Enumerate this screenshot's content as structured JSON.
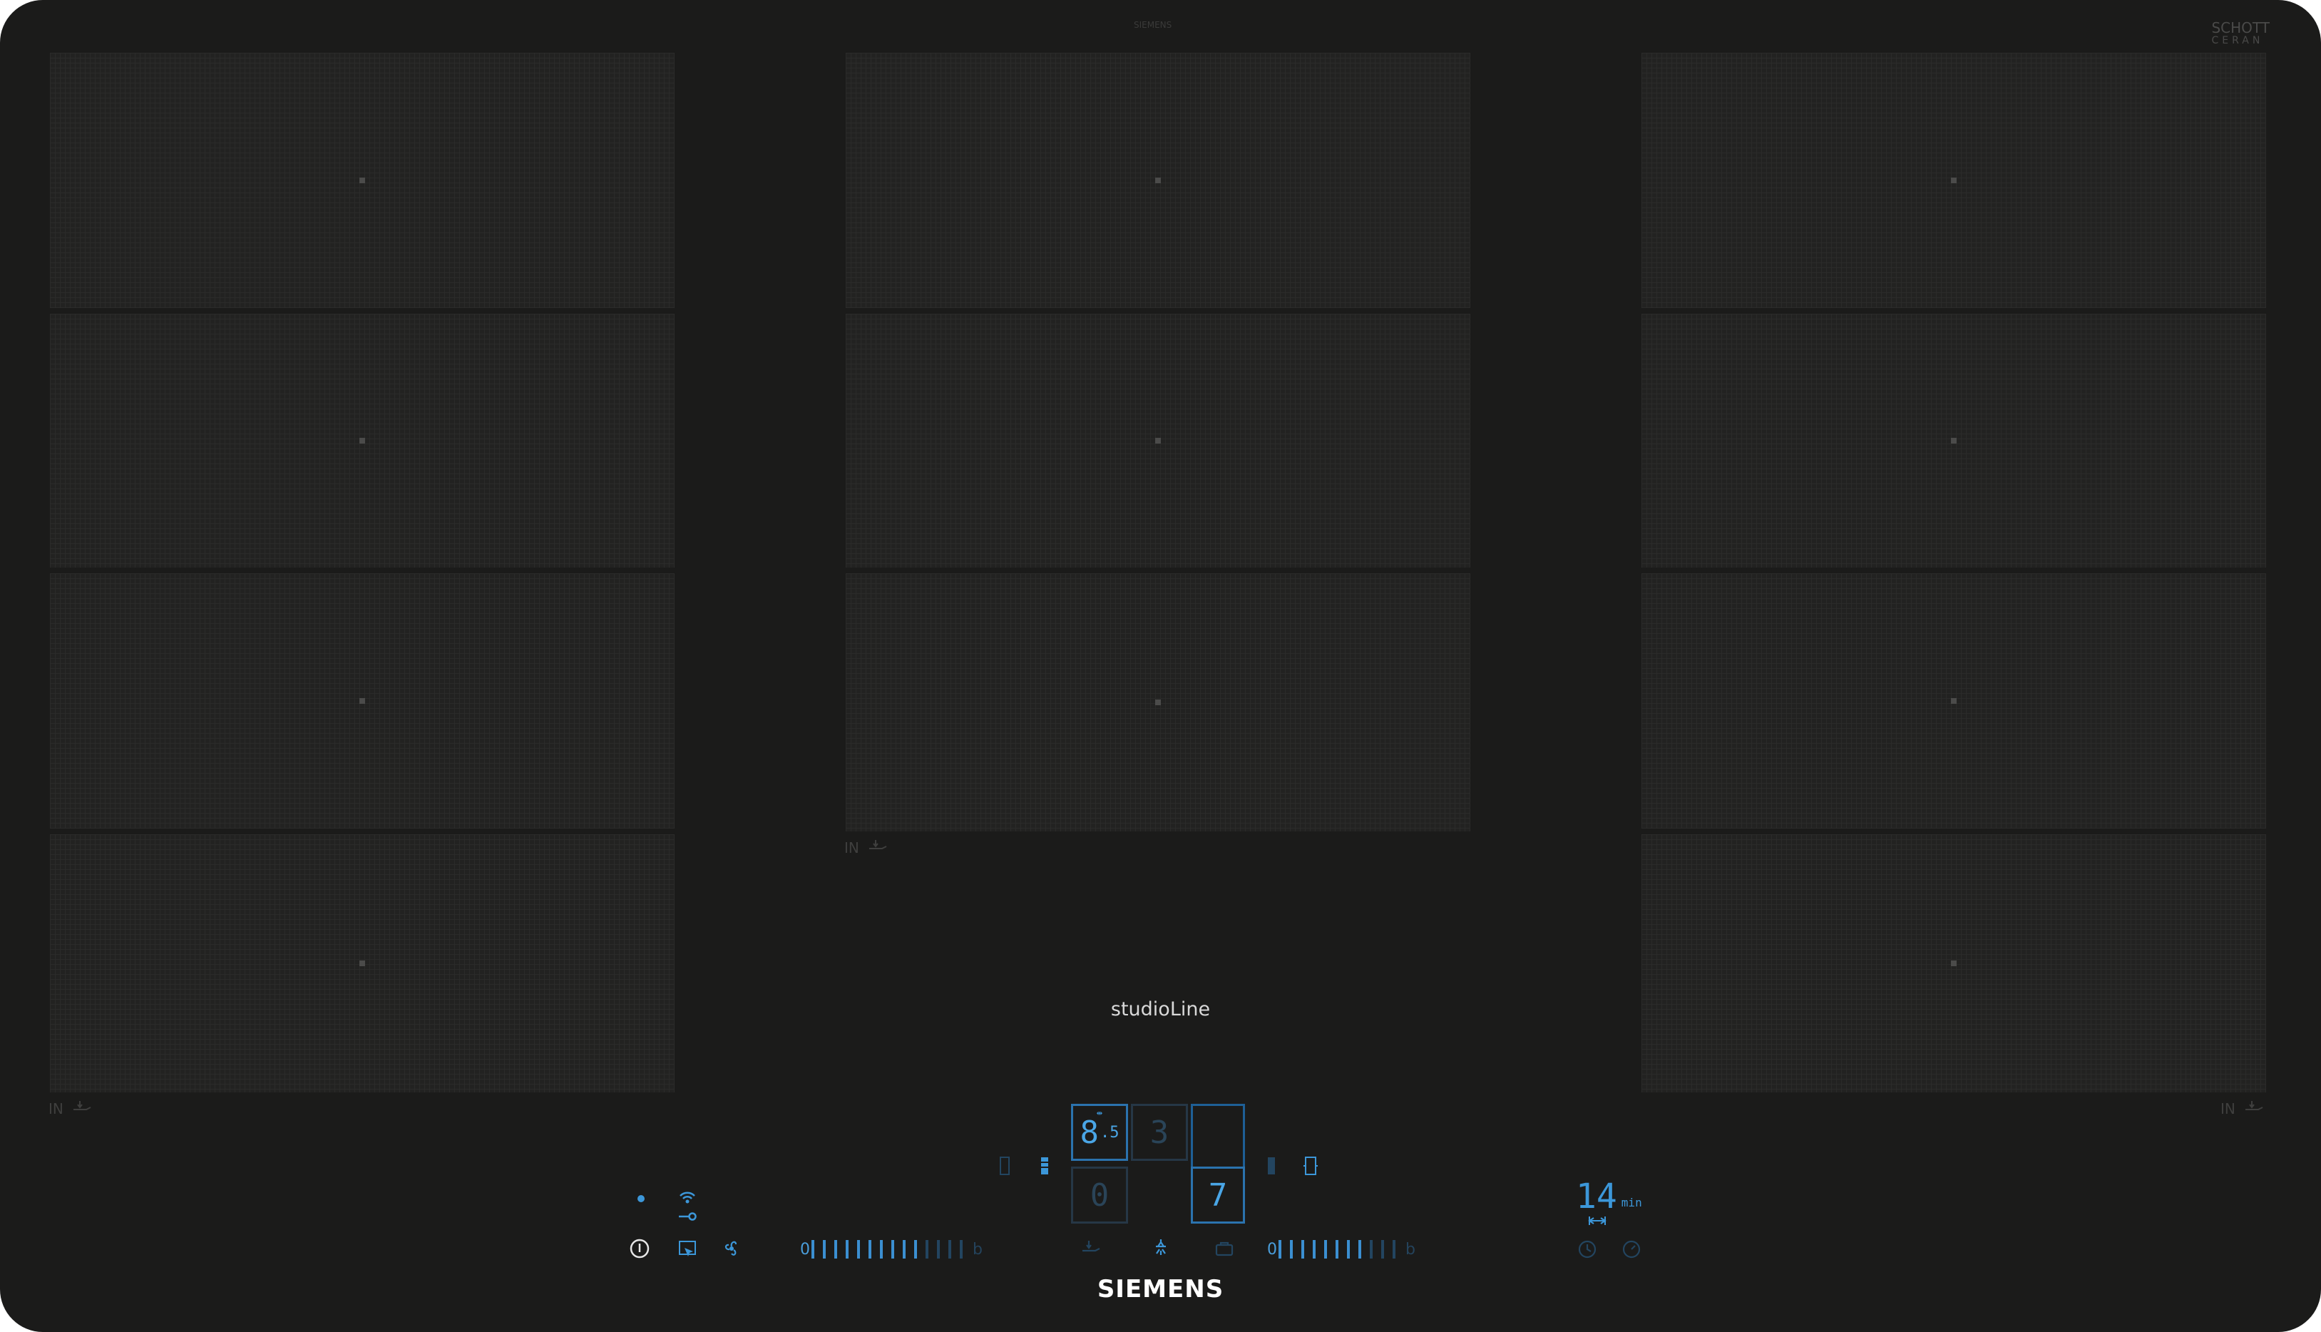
{
  "surface": {
    "top_mark": "SIEMENS",
    "glass_brand_line1": "SCHOTT",
    "glass_brand_line2": "CERAN"
  },
  "zones": {
    "left": {
      "label": "IN"
    },
    "center": {
      "label": "IN"
    },
    "right": {
      "label": "IN"
    }
  },
  "series_name": "studioLine",
  "brand": "SIEMENS",
  "displays": {
    "top_left_value": "8",
    "top_left_decimal": ".5",
    "top_middle_value": "3",
    "bottom_left_value": "0",
    "bottom_right_value": "7"
  },
  "sliders": {
    "left": {
      "min_label": "0",
      "max_label": "b",
      "level": 10,
      "steps": 14
    },
    "right": {
      "min_label": "0",
      "max_label": "b",
      "level": 8,
      "steps": 11
    }
  },
  "timer": {
    "value": "14",
    "unit": "min"
  },
  "colors": {
    "glass": "#1b1b1a",
    "zone": "#222221",
    "display_blue": "#3c97d9",
    "display_dim": "#234560",
    "text_white": "#ffffff"
  },
  "icons": {
    "power": "power-icon",
    "wifi": "wifi-icon",
    "homeconnect": "home-connect-icon",
    "panel_lock": "panel-lock-icon",
    "fan": "hood-fan-icon",
    "frying": "frying-sensor-icon",
    "light": "hood-light-icon",
    "cooking_sensor": "cooking-sensor-icon",
    "timer": "timer-icon",
    "stopwatch": "stopwatch-icon"
  }
}
